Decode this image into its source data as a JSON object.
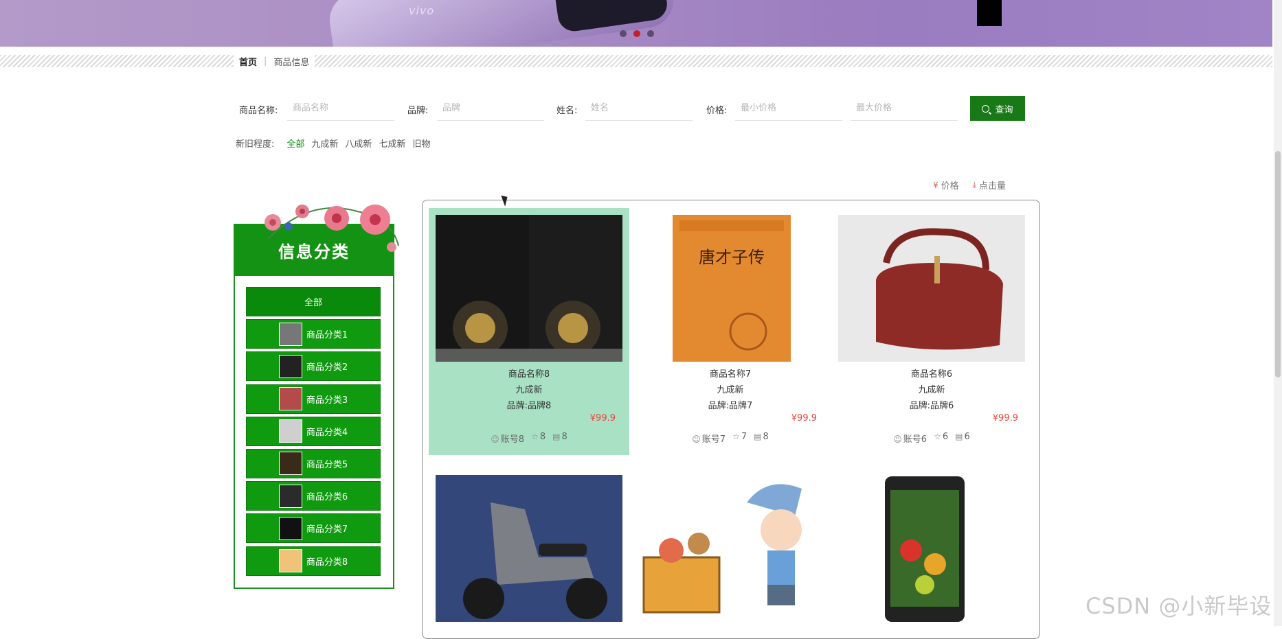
{
  "banner": {
    "brand_logo": "vivo"
  },
  "breadcrumb": {
    "home": "首页",
    "current": "商品信息"
  },
  "search": {
    "name_label": "商品名称:",
    "name_placeholder": "商品名称",
    "brand_label": "品牌:",
    "brand_placeholder": "品牌",
    "person_label": "姓名:",
    "person_placeholder": "姓名",
    "price_label": "价格:",
    "min_placeholder": "最小价格",
    "max_placeholder": "最大价格",
    "query_label": "查询"
  },
  "condition": {
    "label": "新旧程度:",
    "options": [
      "全部",
      "九成新",
      "八成新",
      "七成新",
      "旧物"
    ],
    "selected": "全部"
  },
  "sort": {
    "price_label": "价格",
    "clicks_label": "点击量",
    "price_icon": "yen-icon",
    "clicks_icon": "download-icon"
  },
  "category_panel": {
    "title": "信息分类",
    "items": [
      "全部",
      "商品分类1",
      "商品分类2",
      "商品分类3",
      "商品分类4",
      "商品分类5",
      "商品分类6",
      "商品分类7",
      "商品分类8"
    ]
  },
  "products": [
    {
      "name": "商品名称8",
      "condition": "九成新",
      "brand": "品牌:品牌8",
      "price": "¥99.9",
      "account": "账号8",
      "favorites": "8",
      "comments": "8",
      "image": "speakers-photo"
    },
    {
      "name": "商品名称7",
      "condition": "九成新",
      "brand": "品牌:品牌7",
      "price": "¥99.9",
      "account": "账号7",
      "favorites": "7",
      "comments": "8",
      "image": "book-cover-photo"
    },
    {
      "name": "商品名称6",
      "condition": "九成新",
      "brand": "品牌:品牌6",
      "price": "¥99.9",
      "account": "账号6",
      "favorites": "6",
      "comments": "6",
      "image": "handbag-photo"
    },
    {
      "image": "scooter-photo"
    },
    {
      "image": "cartoon-toys-photo"
    },
    {
      "image": "phone-photo"
    }
  ],
  "book_cover_title": "唐才子传",
  "watermark": "CSDN @小新毕设",
  "colors": {
    "primary_green": "#139213",
    "price_red": "#e8473f",
    "highlight": "#a9e1c4"
  }
}
